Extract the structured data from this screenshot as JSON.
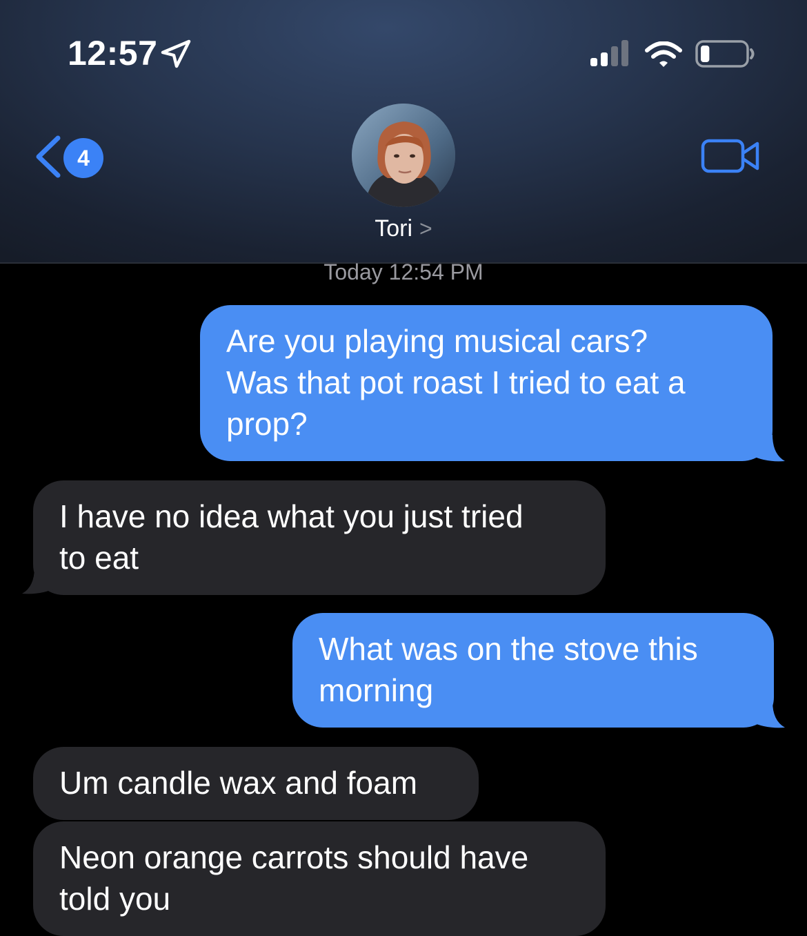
{
  "status_bar": {
    "time": "12:57",
    "location_icon": "location-arrow-icon",
    "signal_icon": "cellular-signal-icon",
    "wifi_icon": "wifi-icon",
    "battery_icon": "battery-low-icon",
    "battery_level": 0.2
  },
  "nav": {
    "back_count": "4",
    "contact_name": "Tori",
    "contact_chevron": ">",
    "video_icon": "video-camera-icon",
    "accent_color": "#3b82f6"
  },
  "thread": {
    "timestamp": "Today 12:54 PM",
    "messages": [
      {
        "direction": "sent",
        "text": "Are you playing musical cars?\nWas that pot roast I tried to eat a\nprop?"
      },
      {
        "direction": "received",
        "text": "I have no idea what you just tried\nto eat"
      },
      {
        "direction": "sent",
        "text": "What was on the stove this\nmorning"
      },
      {
        "direction": "received",
        "text": "Um candle wax and foam"
      },
      {
        "direction": "received",
        "text": "Neon orange carrots should have\ntold you"
      }
    ],
    "sent_color": "#4a8ef3",
    "received_color": "#26262a"
  }
}
